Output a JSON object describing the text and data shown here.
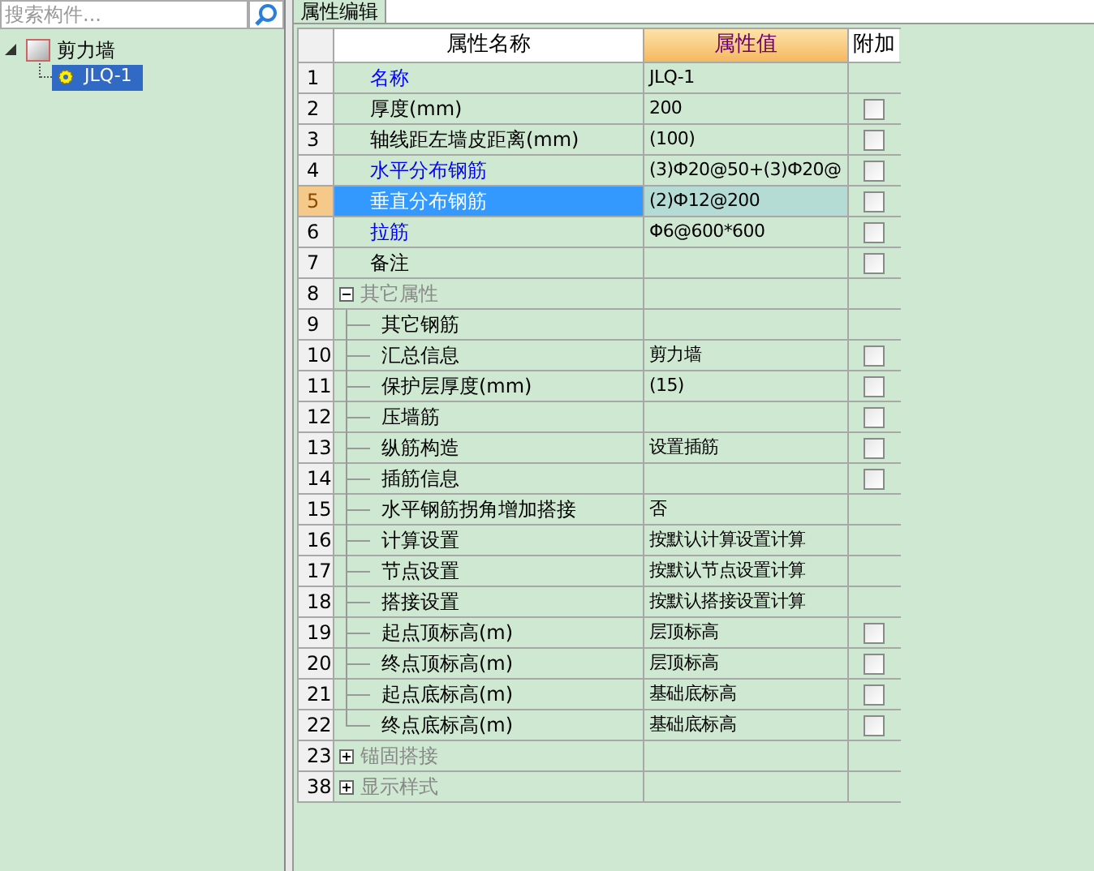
{
  "search": {
    "placeholder": "搜索构件..."
  },
  "tree": [
    {
      "label": "剪力墙",
      "expanded": true,
      "selected": false,
      "children": [
        {
          "label": "JLQ-1",
          "selected": true
        }
      ]
    }
  ],
  "panel_tab": {
    "label": "属性编辑"
  },
  "table": {
    "columns": [
      "属性名称",
      "属性值",
      "附加"
    ],
    "rows": [
      {
        "num": "1",
        "name": "名称",
        "value": "JLQ-1",
        "emphasized": true,
        "selected": false
      },
      {
        "num": "2",
        "name": "厚度(mm)",
        "value": "200",
        "emphasized": false,
        "selected": false,
        "checked": false
      },
      {
        "num": "3",
        "name": "轴线距左墙皮距离(mm)",
        "value": "(100)",
        "emphasized": false,
        "selected": false,
        "checked": false
      },
      {
        "num": "4",
        "name": "水平分布钢筋",
        "value": "(3)Ф20@50+(3)Ф20@",
        "emphasized": true,
        "selected": false,
        "checked": false
      },
      {
        "num": "5",
        "name": "垂直分布钢筋",
        "value": "(2)Ф12@200",
        "emphasized": true,
        "selected": true,
        "checked": false
      },
      {
        "num": "6",
        "name": "拉筋",
        "value": "Φ6@600*600",
        "emphasized": true,
        "selected": false,
        "checked": false
      },
      {
        "num": "7",
        "name": "备注",
        "emphasized": false,
        "selected": false,
        "checked": false
      },
      {
        "num": "8",
        "name": "其它属性",
        "kind": "group",
        "expanded": true,
        "selected": false,
        "children": [
          {
            "num": "9",
            "name": "其它钢筋",
            "selected": false
          },
          {
            "num": "10",
            "name": "汇总信息",
            "value": "剪力墙",
            "selected": false,
            "checked": false
          },
          {
            "num": "11",
            "name": "保护层厚度(mm)",
            "value": "(15)",
            "selected": false,
            "checked": false
          },
          {
            "num": "12",
            "name": "压墙筋",
            "selected": false,
            "checked": false
          },
          {
            "num": "13",
            "name": "纵筋构造",
            "value": "设置插筋",
            "selected": false,
            "checked": false
          },
          {
            "num": "14",
            "name": "插筋信息",
            "selected": false,
            "checked": false
          },
          {
            "num": "15",
            "name": "水平钢筋拐角增加搭接",
            "value": "否",
            "selected": false
          },
          {
            "num": "16",
            "name": "计算设置",
            "value": "按默认计算设置计算",
            "selected": false
          },
          {
            "num": "17",
            "name": "节点设置",
            "value": "按默认节点设置计算",
            "selected": false
          },
          {
            "num": "18",
            "name": "搭接设置",
            "value": "按默认搭接设置计算",
            "selected": false
          },
          {
            "num": "19",
            "name": "起点顶标高(m)",
            "value": "层顶标高",
            "selected": false,
            "checked": false
          },
          {
            "num": "20",
            "name": "终点顶标高(m)",
            "value": "层顶标高",
            "selected": false,
            "checked": false
          },
          {
            "num": "21",
            "name": "起点底标高(m)",
            "value": "基础底标高",
            "selected": false,
            "checked": false
          },
          {
            "num": "22",
            "name": "终点底标高(m)",
            "value": "基础底标高",
            "selected": false,
            "checked": false
          }
        ]
      },
      {
        "num": "23",
        "name": "锚固搭接",
        "kind": "group",
        "expanded": false,
        "selected": false
      },
      {
        "num": "38",
        "name": "显示样式",
        "kind": "group",
        "expanded": false,
        "selected": false
      }
    ]
  }
}
